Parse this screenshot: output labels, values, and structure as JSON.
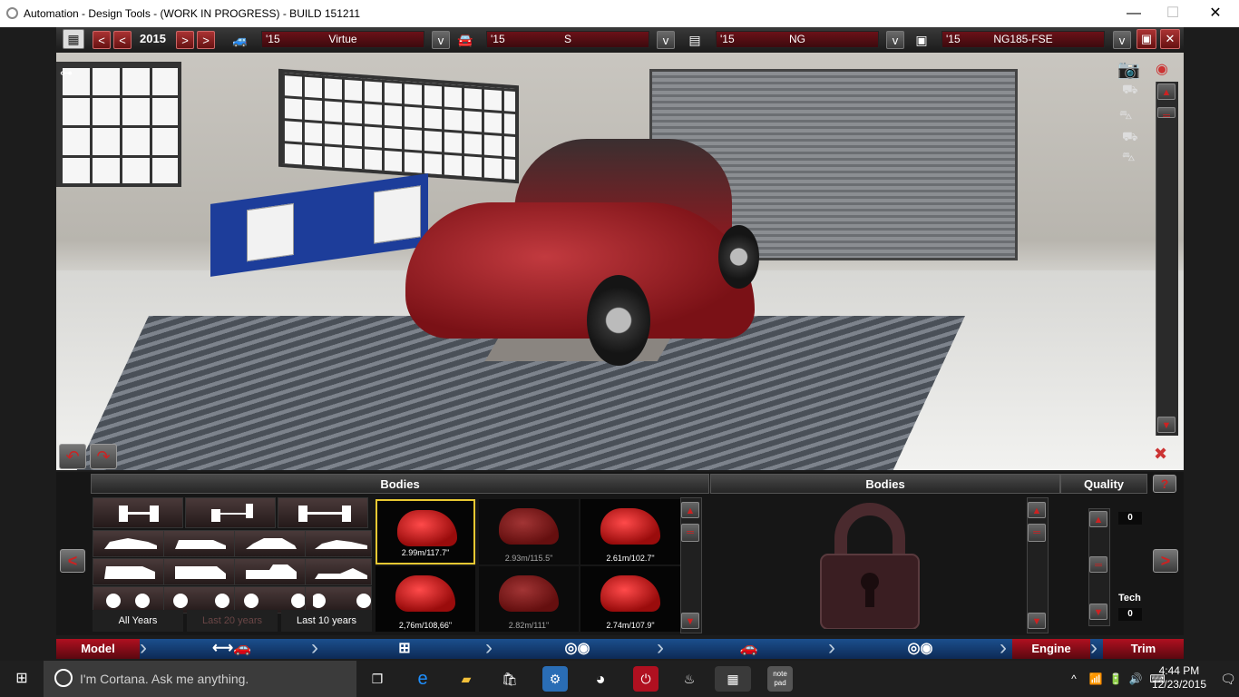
{
  "window": {
    "title": "Automation - Design Tools - (WORK IN PROGRESS) - BUILD 151211",
    "minimize": "—",
    "maximize": "☐",
    "close": "✕"
  },
  "toolbar": {
    "year": "2015",
    "prev_label": "<",
    "next_label": ">",
    "selectors": [
      {
        "year": "'15",
        "name": "Virtue"
      },
      {
        "year": "'15",
        "name": "S"
      },
      {
        "year": "'15",
        "name": "NG"
      },
      {
        "year": "'15",
        "name": "NG185-FSE"
      }
    ],
    "dropdown_label": "v"
  },
  "left_panel": {
    "header": "Bodies",
    "years": [
      "All Years",
      "Last 20 years",
      "Last 10 years"
    ],
    "prev_label": "<"
  },
  "bodies": [
    {
      "caption": "2.99m/117.7\""
    },
    {
      "caption": "2.93m/115.5\""
    },
    {
      "caption": "2.61m/102.7\""
    },
    {
      "caption": "2,76m/108,66\""
    },
    {
      "caption": "2.82m/111\""
    },
    {
      "caption": "2.74m/107.9\""
    }
  ],
  "center_panel": {
    "header": "Bodies"
  },
  "quality_panel": {
    "header": "Quality",
    "help_label": "?",
    "quality_value": "0",
    "tech_label": "Tech",
    "tech_value": "0",
    "next_label": ">"
  },
  "nav": {
    "model": "Model",
    "engine": "Engine",
    "trim": "Trim"
  },
  "taskbar": {
    "cortana_placeholder": "I'm Cortana. Ask me anything.",
    "notepad_label": "note pad",
    "time": "4:44 PM",
    "date": "12/23/2015"
  },
  "colors": {
    "accent_red": "#b01020",
    "nav_blue": "#1b4f8d",
    "car_red": "#a51c24"
  }
}
